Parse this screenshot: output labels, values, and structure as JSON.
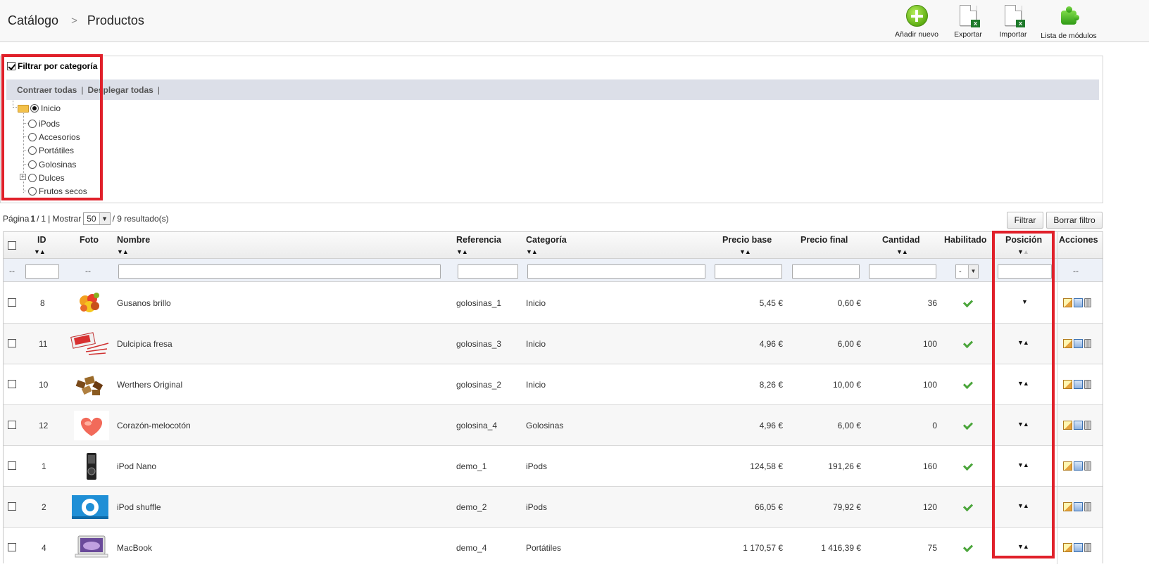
{
  "breadcrumb": {
    "parent": "Catálogo",
    "current": "Productos"
  },
  "toolbar": {
    "add_new": "Añadir nuevo",
    "export": "Exportar",
    "import": "Importar",
    "modules": "Lista de módulos"
  },
  "category_filter": {
    "label": "Filtrar por categoría",
    "collapse_all": "Contraer todas",
    "expand_all": "Desplegar todas",
    "separator": "|",
    "tree": [
      {
        "label": "Inicio",
        "selected": true
      },
      {
        "label": "iPods"
      },
      {
        "label": "Accesorios"
      },
      {
        "label": "Portátiles"
      },
      {
        "label": "Golosinas"
      },
      {
        "label": "Dulces",
        "expandable": true
      },
      {
        "label": "Frutos secos"
      }
    ]
  },
  "pager": {
    "page_label": "Página",
    "page": "1",
    "pages": "1",
    "show_label": "| Mostrar",
    "per_page": "50",
    "results": "/ 9 resultado(s)",
    "of": "/"
  },
  "buttons": {
    "filter": "Filtrar",
    "clear_filter": "Borrar filtro"
  },
  "table": {
    "headers": {
      "id": "ID",
      "photo": "Foto",
      "name": "Nombre",
      "reference": "Referencia",
      "category": "Categoría",
      "base_price": "Precio base",
      "final_price": "Precio final",
      "quantity": "Cantidad",
      "enabled": "Habilitado",
      "position": "Posición",
      "actions": "Acciones"
    },
    "filter_row": {
      "dash": "--",
      "enabled_select": "-"
    },
    "rows": [
      {
        "id": "8",
        "name": "Gusanos brillo",
        "reference": "golosinas_1",
        "category": "Inicio",
        "base_price": "5,45 €",
        "final_price": "0,60 €",
        "quantity": "36",
        "thumb": "candy"
      },
      {
        "id": "11",
        "name": "Dulcipica fresa",
        "reference": "golosinas_3",
        "category": "Inicio",
        "base_price": "4,96 €",
        "final_price": "6,00 €",
        "quantity": "100",
        "thumb": "sticks"
      },
      {
        "id": "10",
        "name": "Werthers Original",
        "reference": "golosinas_2",
        "category": "Inicio",
        "base_price": "8,26 €",
        "final_price": "10,00 €",
        "quantity": "100",
        "thumb": "toffee"
      },
      {
        "id": "12",
        "name": "Corazón-melocotón",
        "reference": "golosina_4",
        "category": "Golosinas",
        "base_price": "4,96 €",
        "final_price": "6,00 €",
        "quantity": "0",
        "thumb": "heart"
      },
      {
        "id": "1",
        "name": "iPod Nano",
        "reference": "demo_1",
        "category": "iPods",
        "base_price": "124,58 €",
        "final_price": "191,26 €",
        "quantity": "160",
        "thumb": "nano"
      },
      {
        "id": "2",
        "name": "iPod shuffle",
        "reference": "demo_2",
        "category": "iPods",
        "base_price": "66,05 €",
        "final_price": "79,92 €",
        "quantity": "120",
        "thumb": "shuffle"
      },
      {
        "id": "4",
        "name": "MacBook",
        "reference": "demo_4",
        "category": "Portátiles",
        "base_price": "1 170,57 €",
        "final_price": "1 416,39 €",
        "quantity": "75",
        "thumb": "macbook"
      }
    ]
  },
  "colors": {
    "highlight": "#e0202a",
    "filter_bar": "#dcdfe8",
    "check": "#4aa53a"
  }
}
